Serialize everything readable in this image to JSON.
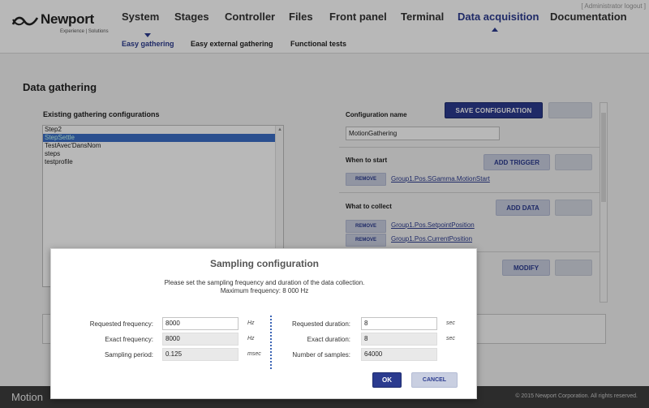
{
  "header": {
    "logo_text": "Newport",
    "logo_tagline": "Experience | Solutions",
    "user_link": "[ Administrator logout ]",
    "nav": [
      "System",
      "Stages",
      "Controller",
      "Files",
      "Front panel",
      "Terminal",
      "Data acquisition",
      "Documentation"
    ],
    "active_nav": "Data acquisition",
    "subnav": [
      "Easy gathering",
      "Easy external gathering",
      "Functional tests"
    ],
    "active_subnav": "Easy gathering"
  },
  "page": {
    "title": "Data gathering",
    "list_title": "Existing gathering configurations",
    "configs": [
      "Step2",
      "StepSettle",
      "TestAvec'DansNom",
      "steps",
      "testprofile"
    ],
    "selected_config": "StepSettle"
  },
  "right_panel": {
    "config_name_label": "Configuration name",
    "config_name_value": "MotionGathering",
    "save_button": "SAVE CONFIGURATION",
    "when_to_start_label": "When to start",
    "add_trigger_button": "ADD TRIGGER",
    "remove_label": "REMOVE",
    "trigger": "Group1.Pos.SGamma.MotionStart",
    "what_to_collect_label": "What to collect",
    "add_data_button": "ADD DATA",
    "data_items": [
      "Group1.Pos.SetpointPosition",
      "Group1.Pos.CurrentPosition"
    ],
    "modify_button": "MODIFY"
  },
  "footer": {
    "left": "Motion",
    "copyright": "© 2015 Newport Corporation. All rights reserved."
  },
  "modal": {
    "title": "Sampling configuration",
    "desc_line1": "Please set the sampling frequency and duration of the data collection.",
    "desc_line2": "Maximum frequency: 8 000 Hz",
    "requested_frequency_label": "Requested frequency:",
    "requested_frequency": "8000",
    "exact_frequency_label": "Exact frequency:",
    "exact_frequency": "8000",
    "sampling_period_label": "Sampling period:",
    "sampling_period": "0.125",
    "unit_hz": "Hz",
    "unit_msec": "msec",
    "requested_duration_label": "Requested duration:",
    "requested_duration": "8",
    "exact_duration_label": "Exact duration:",
    "exact_duration": "8",
    "number_of_samples_label": "Number of samples:",
    "number_of_samples": "64000",
    "unit_sec": "sec",
    "ok_button": "OK",
    "cancel_button": "CANCEL"
  },
  "colors": {
    "accent": "#2b3b8f",
    "selection": "#3b6ec6",
    "footer_bg": "#3d3d3d"
  }
}
